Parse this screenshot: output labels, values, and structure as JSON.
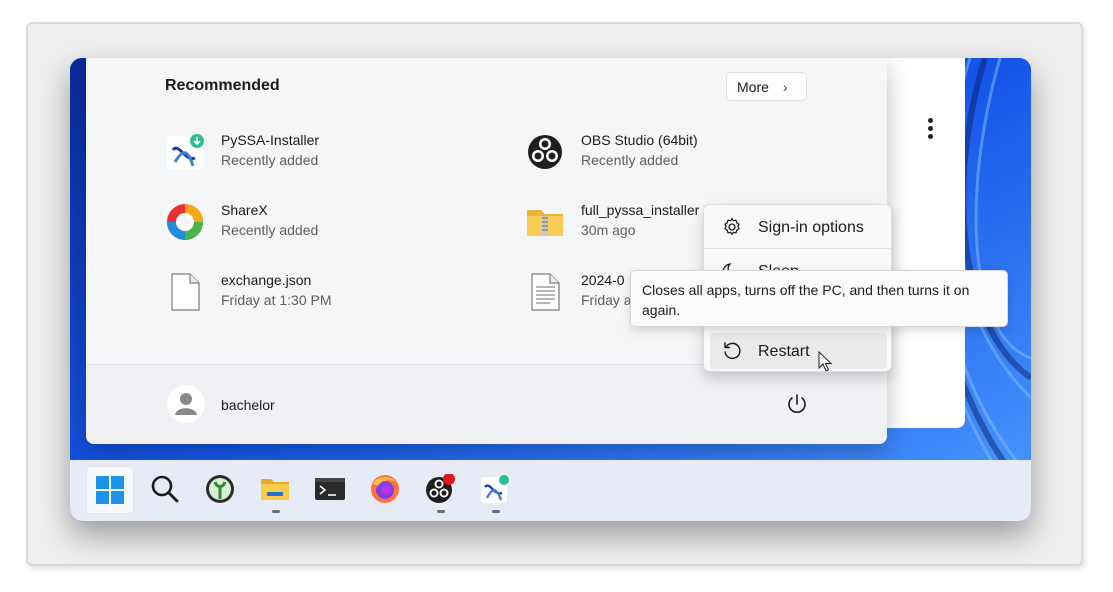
{
  "start_menu": {
    "recommended_title": "Recommended",
    "more_button": "More",
    "items": [
      {
        "name": "PySSA-Installer",
        "sub": "Recently added",
        "icon": "pyssa-installer-icon"
      },
      {
        "name": "OBS Studio (64bit)",
        "sub": "Recently added",
        "icon": "obs-icon"
      },
      {
        "name": "ShareX",
        "sub": "Recently added",
        "icon": "sharex-icon"
      },
      {
        "name": "full_pyssa_installer",
        "sub": "30m ago",
        "icon": "zip-folder-icon"
      },
      {
        "name": "exchange.json",
        "sub": "Friday at 1:30 PM",
        "icon": "file-icon"
      },
      {
        "name": "2024-0",
        "sub": "Friday a",
        "icon": "text-file-icon"
      }
    ],
    "user": {
      "name": "bachelor",
      "icon": "user-avatar-icon"
    },
    "power_icon": "power-icon"
  },
  "power_menu": {
    "items": [
      {
        "label": "Sign-in options",
        "icon": "gear-icon"
      },
      {
        "label": "Sleep",
        "icon": "moon-icon"
      },
      {
        "label": "Restart",
        "icon": "restart-icon"
      }
    ],
    "tooltip": "Closes all apps, turns off the PC, and then turns it on again."
  },
  "taskbar": {
    "items": [
      {
        "name": "Start",
        "icon": "windows-start-icon",
        "active": true
      },
      {
        "name": "Search",
        "icon": "search-icon"
      },
      {
        "name": "PyMOL",
        "icon": "pymol-icon"
      },
      {
        "name": "File Explorer",
        "icon": "file-explorer-icon",
        "running": true
      },
      {
        "name": "Terminal",
        "icon": "terminal-icon"
      },
      {
        "name": "Firefox",
        "icon": "firefox-icon"
      },
      {
        "name": "OBS Studio",
        "icon": "obs-recording-icon",
        "running": true
      },
      {
        "name": "PySSA-Installer",
        "icon": "pyssa-installer-icon",
        "running": true
      }
    ]
  },
  "colors": {
    "accent": "#0067c0",
    "wallpaper": "#1a4fd6",
    "recording": "#e81123"
  }
}
